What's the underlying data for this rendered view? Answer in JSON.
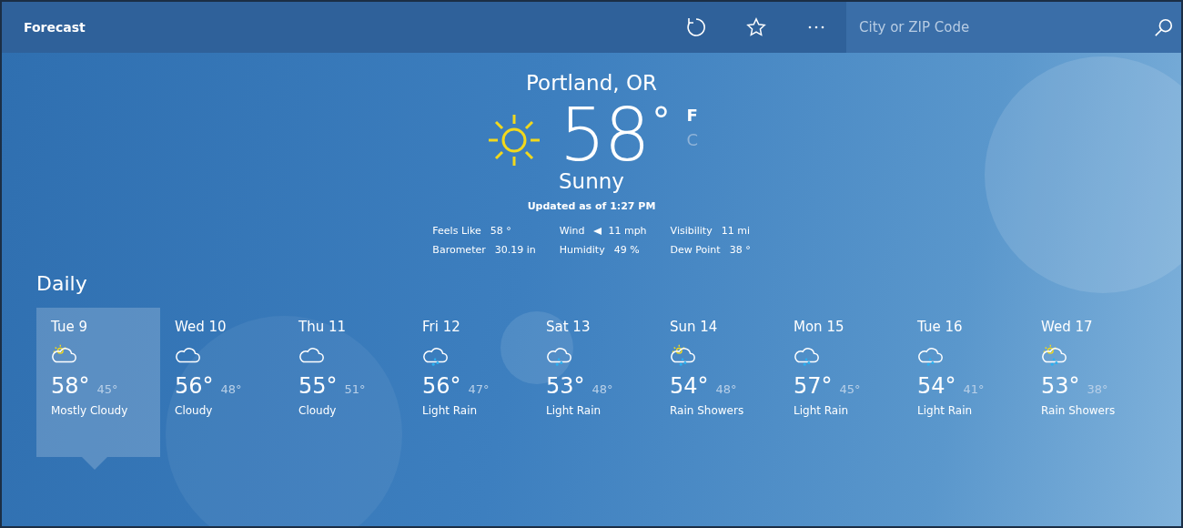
{
  "header": {
    "title": "Forecast",
    "search": {
      "placeholder": "City or ZIP Code"
    }
  },
  "current": {
    "location": "Portland, OR",
    "temperature": "58",
    "degree": "°",
    "condition": "Sunny",
    "updated": "Updated as of 1:27 PM",
    "units": [
      {
        "label": "F",
        "selected": true
      },
      {
        "label": "C",
        "selected": false
      }
    ],
    "details": [
      {
        "label": "Feels Like",
        "value": "58 °",
        "kind": "plain"
      },
      {
        "label": "Wind",
        "value": "11 mph",
        "kind": "wind"
      },
      {
        "label": "Visibility",
        "value": "11 mi",
        "kind": "plain"
      },
      {
        "label": "Barometer",
        "value": "30.19 in",
        "kind": "plain"
      },
      {
        "label": "Humidity",
        "value": "49 %",
        "kind": "plain"
      },
      {
        "label": "Dew Point",
        "value": "38 °",
        "kind": "plain"
      }
    ]
  },
  "daily": {
    "title": "Daily",
    "days": [
      {
        "day": "Tue 9",
        "kind": "partly-cloudy",
        "high": "58°",
        "low": "45°",
        "condition": "Mostly Cloudy",
        "selected": true
      },
      {
        "day": "Wed 10",
        "kind": "cloudy",
        "high": "56°",
        "low": "48°",
        "condition": "Cloudy",
        "selected": false
      },
      {
        "day": "Thu 11",
        "kind": "cloudy",
        "high": "55°",
        "low": "51°",
        "condition": "Cloudy",
        "selected": false
      },
      {
        "day": "Fri 12",
        "kind": "rain",
        "high": "56°",
        "low": "47°",
        "condition": "Light Rain",
        "selected": false
      },
      {
        "day": "Sat 13",
        "kind": "rain",
        "high": "53°",
        "low": "48°",
        "condition": "Light Rain",
        "selected": false
      },
      {
        "day": "Sun 14",
        "kind": "showers",
        "high": "54°",
        "low": "48°",
        "condition": "Rain Showers",
        "selected": false
      },
      {
        "day": "Mon 15",
        "kind": "rain",
        "high": "57°",
        "low": "45°",
        "condition": "Light Rain",
        "selected": false
      },
      {
        "day": "Tue 16",
        "kind": "rain",
        "high": "54°",
        "low": "41°",
        "condition": "Light Rain",
        "selected": false
      },
      {
        "day": "Wed 17",
        "kind": "showers",
        "high": "53°",
        "low": "38°",
        "condition": "Rain Showers",
        "selected": false
      }
    ]
  }
}
